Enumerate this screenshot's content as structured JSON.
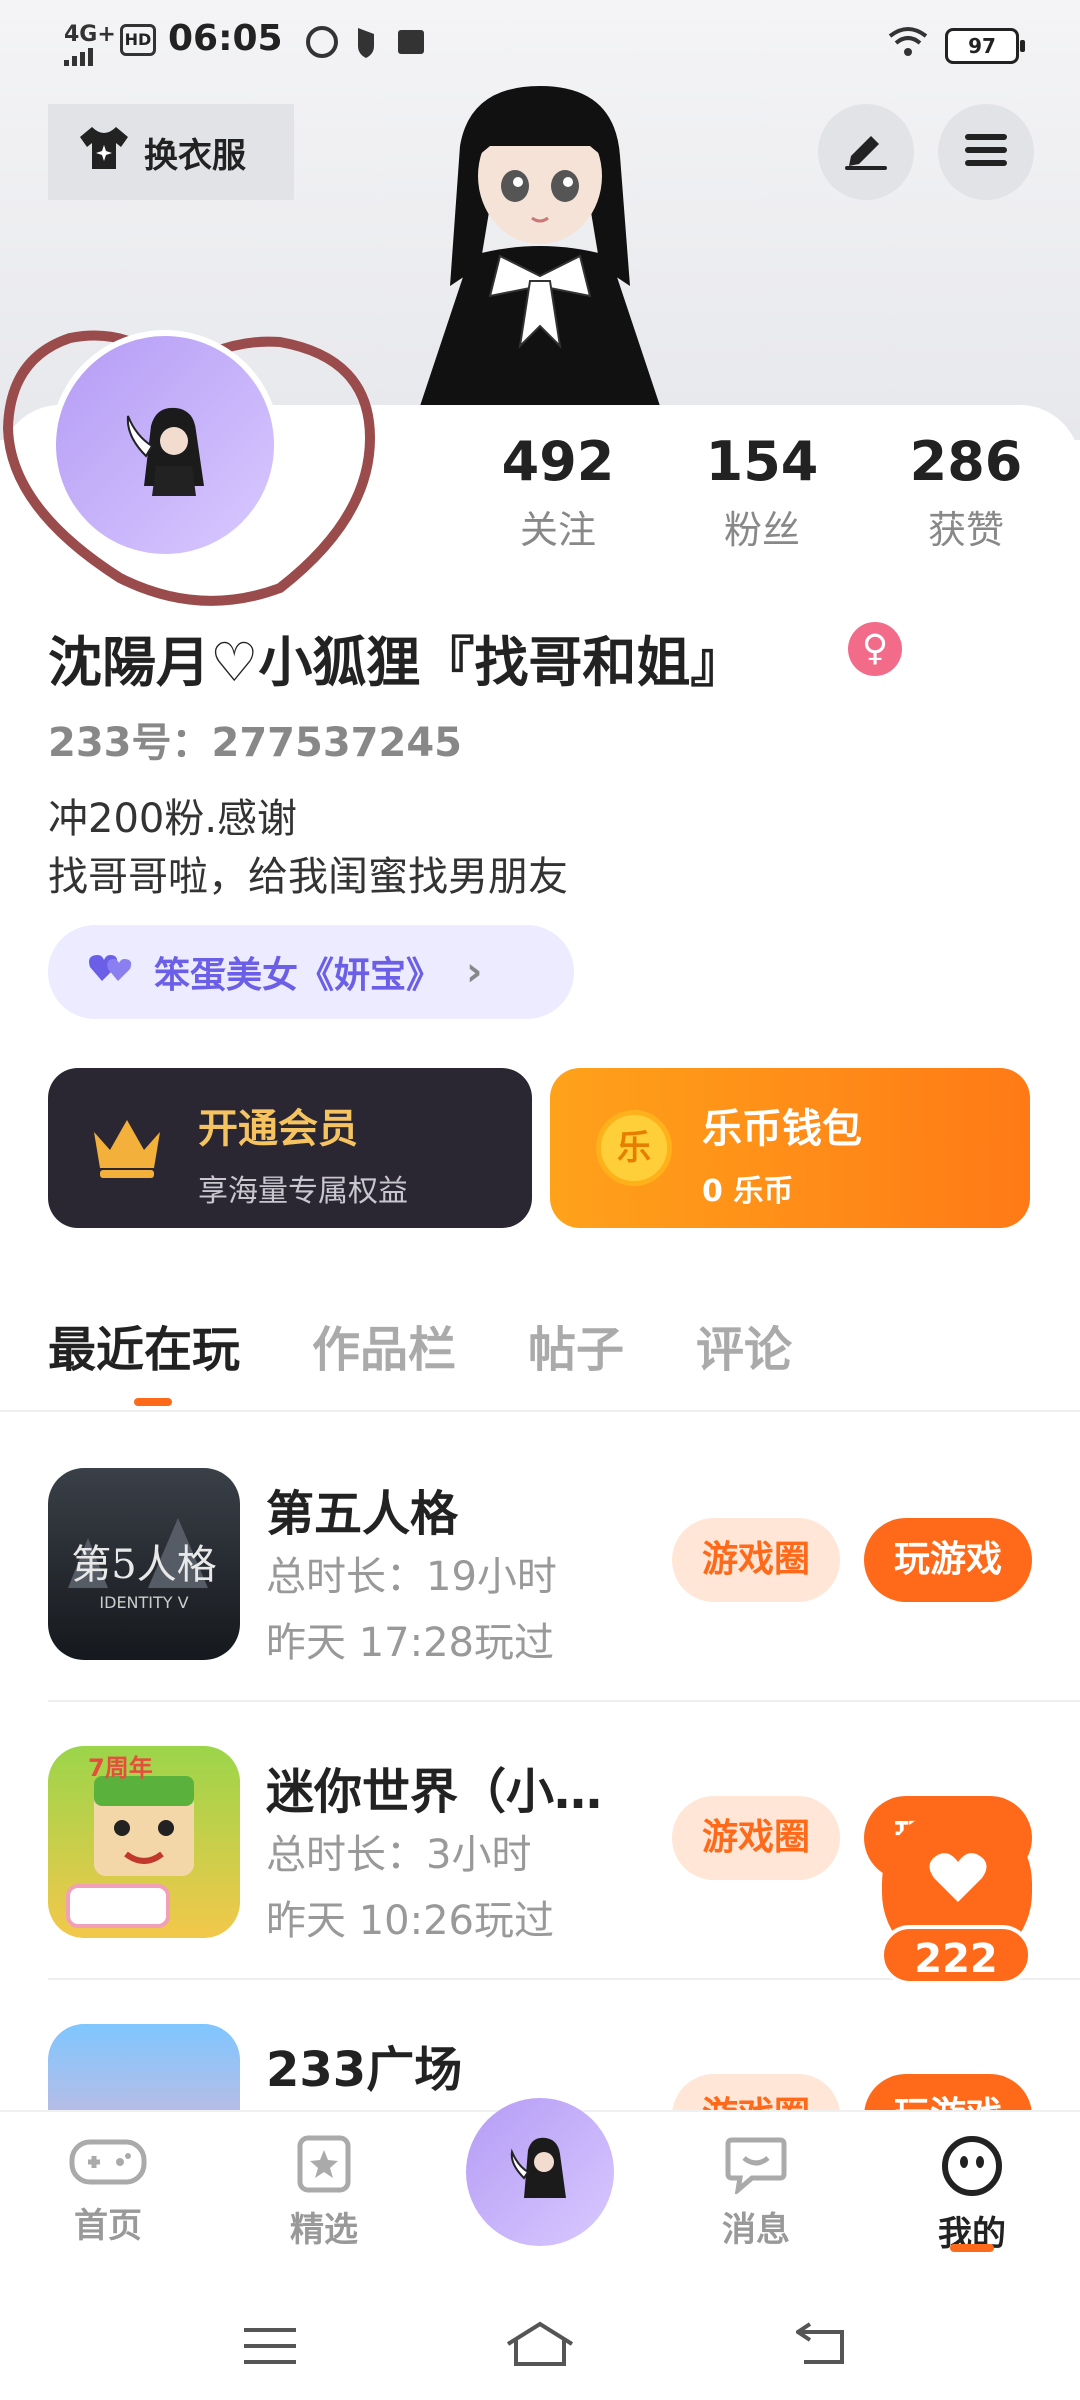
{
  "status_bar": {
    "network": "4G+",
    "time": "06:05",
    "battery": "97"
  },
  "header": {
    "costume_label": "换衣服"
  },
  "stats": [
    {
      "value": "492",
      "label": "关注"
    },
    {
      "value": "154",
      "label": "粉丝"
    },
    {
      "value": "286",
      "label": "获赞"
    }
  ],
  "profile": {
    "name": "沈陽月♡小狐狸『找哥和姐』",
    "gender_symbol": "♀",
    "uid": "233号：277537245",
    "bio_line1": "冲200粉.感谢",
    "bio_line2": "找哥哥啦，给我闺蜜找男朋友",
    "relation_tag": "笨蛋美女《妍宝》",
    "relation_chevron": "›"
  },
  "cards": {
    "vip_title": "开通会员",
    "vip_sub": "享海量专属权益",
    "wallet_title": "乐币钱包",
    "wallet_sub": "0 乐币",
    "wallet_coin": "乐"
  },
  "tabs": [
    "最近在玩",
    "作品栏",
    "帖子",
    "评论"
  ],
  "games": [
    {
      "name": "第五人格",
      "duration": "总时长：19小时",
      "last_played": "昨天 17:28玩过",
      "btn_circle": "游戏圈",
      "btn_play": "玩游戏"
    },
    {
      "name": "迷你世界（小…",
      "duration": "总时长：3小时",
      "last_played": "昨天 10:26玩过",
      "btn_circle": "游戏圈",
      "btn_play": "玩游戏"
    },
    {
      "name": "233广场",
      "duration": "",
      "last_played": "",
      "btn_circle": "游戏圈",
      "btn_play": "玩游戏"
    }
  ],
  "floating_like": {
    "count": "222"
  },
  "bottom_nav": [
    {
      "label": "首页",
      "icon": "gamepad-icon"
    },
    {
      "label": "精选",
      "icon": "star-icon"
    },
    {
      "label": "消息",
      "icon": "chat-icon"
    },
    {
      "label": "我的",
      "icon": "smile-icon"
    }
  ],
  "colors": {
    "accent": "#ff6a1a",
    "purple": "#6b5ee7",
    "vip_bg": "#2a2733"
  }
}
